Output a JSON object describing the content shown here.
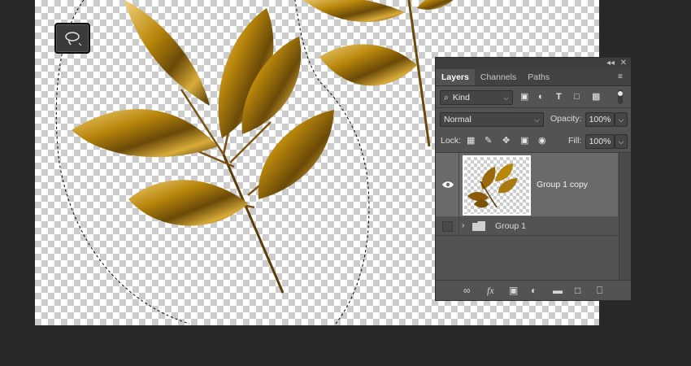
{
  "layers_panel": {
    "tabs": [
      {
        "label": "Layers",
        "active": true
      },
      {
        "label": "Channels",
        "active": false
      },
      {
        "label": "Paths",
        "active": false
      }
    ],
    "collapse_glyph": "◂◂",
    "close_glyph": "✕",
    "menu_glyph": "≡",
    "filter": {
      "kind_label": "Kind",
      "search_glyph": "⌕"
    },
    "blend_mode": "Normal",
    "opacity_label": "Opacity:",
    "opacity_value": "100%",
    "lock_label": "Lock:",
    "fill_label": "Fill:",
    "fill_value": "100%",
    "layers": [
      {
        "name": "Group 1 copy",
        "visible": true,
        "selected": true
      },
      {
        "name": "Group 1",
        "visible": false,
        "selected": false,
        "type": "group"
      }
    ],
    "bottom_icons": [
      "link-icon",
      "fx-icon",
      "mask-icon",
      "adjustment-icon",
      "folder-icon",
      "new-layer-icon",
      "trash-icon"
    ],
    "fx_label": "fx",
    "type_glyph": "T"
  },
  "toolbar": {
    "active_tool": "lasso-icon"
  },
  "colors": {
    "app_bg": "#282828",
    "panel_bg": "#535353",
    "selected_layer_bg": "#6a6a6a",
    "gold": "#b8860b"
  }
}
